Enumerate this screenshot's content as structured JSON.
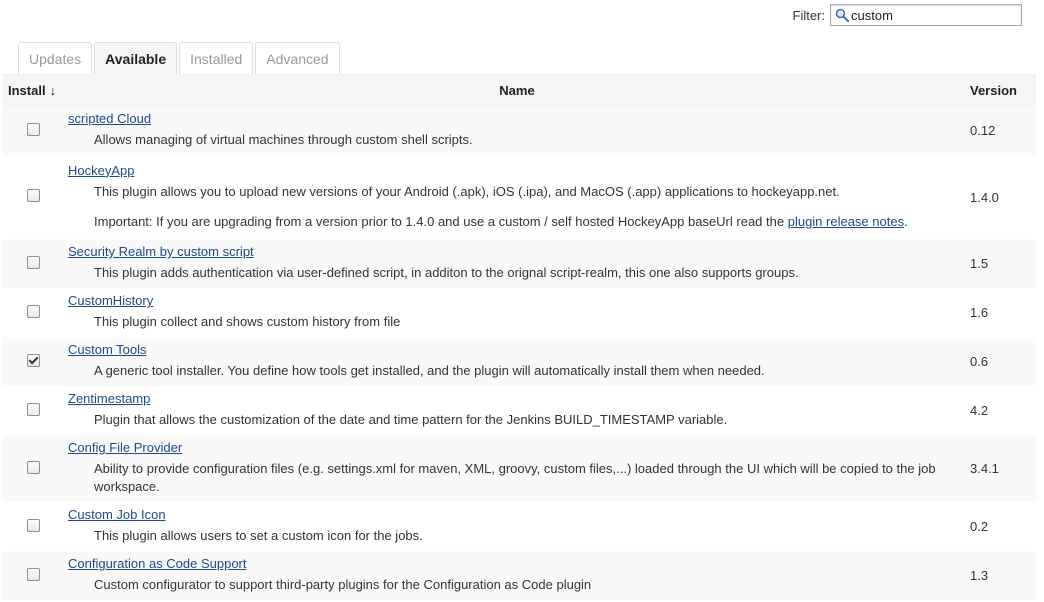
{
  "filter": {
    "label": "Filter:",
    "value": "custom"
  },
  "tabs": [
    {
      "label": "Updates",
      "active": false
    },
    {
      "label": "Available",
      "active": true
    },
    {
      "label": "Installed",
      "active": false
    },
    {
      "label": "Advanced",
      "active": false
    }
  ],
  "table": {
    "headers": {
      "install": "Install",
      "sort_indicator": "↓",
      "name": "Name",
      "version": "Version"
    },
    "rows": [
      {
        "name": "scripted Cloud",
        "description": "Allows managing of virtual machines through custom shell scripts.",
        "version": "0.12",
        "checked": false
      },
      {
        "name": "HockeyApp",
        "description": "This plugin allows you to upload new versions of your Android (.apk), iOS (.ipa), and MacOS (.app) applications to hockeyapp.net.",
        "note_prefix": "Important: If you are upgrading from a version prior to 1.4.0 and use a custom / self hosted HockeyApp baseUrl read the ",
        "note_link": "plugin release notes",
        "note_suffix": ".",
        "version": "1.4.0",
        "checked": false
      },
      {
        "name": "Security Realm by custom script",
        "description": "This plugin adds authentication via user-defined script, in additon to the orignal script-realm, this one also supports groups.",
        "version": "1.5",
        "checked": false
      },
      {
        "name": "CustomHistory",
        "description": "This plugin collect and shows custom history from file",
        "version": "1.6",
        "checked": false
      },
      {
        "name": "Custom Tools",
        "description": "A generic tool installer. You define how tools get installed, and the plugin will automatically install them when needed.",
        "version": "0.6",
        "checked": true
      },
      {
        "name": "Zentimestamp",
        "description": "Plugin that allows the customization of the date and time pattern for the Jenkins BUILD_TIMESTAMP variable.",
        "version": "4.2",
        "checked": false
      },
      {
        "name": "Config File Provider",
        "description": "Ability to provide configuration files (e.g. settings.xml for maven, XML, groovy, custom files,...) loaded through the UI which will be copied to the job workspace.",
        "version": "3.4.1",
        "checked": false
      },
      {
        "name": "Custom Job Icon",
        "description": "This plugin allows users to set a custom icon for the jobs.",
        "version": "0.2",
        "checked": false
      },
      {
        "name": "Configuration as Code Support",
        "description": "Custom configurator to support third-party plugins for the Configuration as Code plugin",
        "version": "1.3",
        "checked": false
      }
    ]
  }
}
